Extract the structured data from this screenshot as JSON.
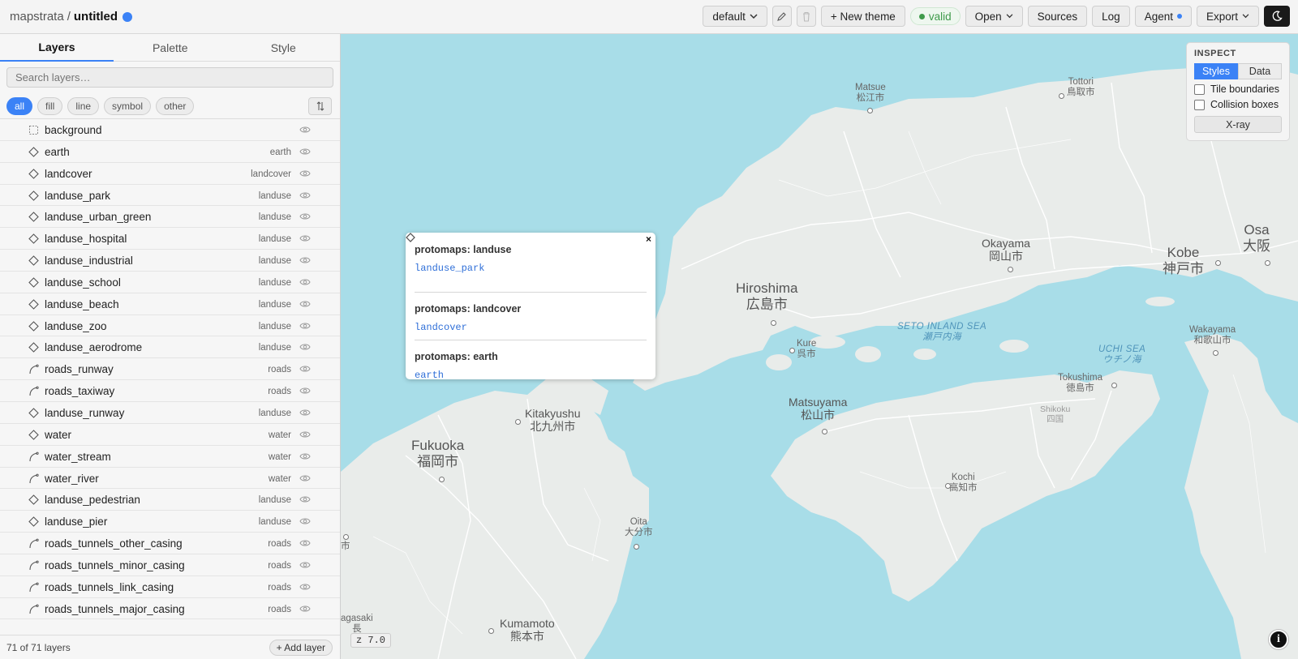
{
  "app": {
    "name": "mapstrata",
    "separator": "/",
    "document": "untitled"
  },
  "toolbar": {
    "theme_select": "default",
    "new_theme": "+ New theme",
    "status": "valid",
    "open": "Open",
    "sources": "Sources",
    "log": "Log",
    "agent": "Agent",
    "export": "Export"
  },
  "sidebar": {
    "tabs": [
      "Layers",
      "Palette",
      "Style"
    ],
    "search_placeholder": "Search layers…",
    "filters": [
      "all",
      "fill",
      "line",
      "symbol",
      "other"
    ],
    "layers": [
      {
        "name": "background",
        "source": "",
        "kind": "background"
      },
      {
        "name": "earth",
        "source": "earth",
        "kind": "fill"
      },
      {
        "name": "landcover",
        "source": "landcover",
        "kind": "fill"
      },
      {
        "name": "landuse_park",
        "source": "landuse",
        "kind": "fill"
      },
      {
        "name": "landuse_urban_green",
        "source": "landuse",
        "kind": "fill"
      },
      {
        "name": "landuse_hospital",
        "source": "landuse",
        "kind": "fill"
      },
      {
        "name": "landuse_industrial",
        "source": "landuse",
        "kind": "fill"
      },
      {
        "name": "landuse_school",
        "source": "landuse",
        "kind": "fill"
      },
      {
        "name": "landuse_beach",
        "source": "landuse",
        "kind": "fill"
      },
      {
        "name": "landuse_zoo",
        "source": "landuse",
        "kind": "fill"
      },
      {
        "name": "landuse_aerodrome",
        "source": "landuse",
        "kind": "fill"
      },
      {
        "name": "roads_runway",
        "source": "roads",
        "kind": "line"
      },
      {
        "name": "roads_taxiway",
        "source": "roads",
        "kind": "line"
      },
      {
        "name": "landuse_runway",
        "source": "landuse",
        "kind": "fill"
      },
      {
        "name": "water",
        "source": "water",
        "kind": "fill"
      },
      {
        "name": "water_stream",
        "source": "water",
        "kind": "line"
      },
      {
        "name": "water_river",
        "source": "water",
        "kind": "line"
      },
      {
        "name": "landuse_pedestrian",
        "source": "landuse",
        "kind": "fill"
      },
      {
        "name": "landuse_pier",
        "source": "landuse",
        "kind": "fill"
      },
      {
        "name": "roads_tunnels_other_casing",
        "source": "roads",
        "kind": "line"
      },
      {
        "name": "roads_tunnels_minor_casing",
        "source": "roads",
        "kind": "line"
      },
      {
        "name": "roads_tunnels_link_casing",
        "source": "roads",
        "kind": "line"
      },
      {
        "name": "roads_tunnels_major_casing",
        "source": "roads",
        "kind": "line"
      }
    ],
    "footer_count": "71 of 71 layers",
    "add_layer": "+ Add layer"
  },
  "popup": {
    "sections": [
      {
        "title": "protomaps: landuse",
        "item": "landuse_park"
      },
      {
        "title": "protomaps: landcover",
        "item": "landcover"
      },
      {
        "title": "protomaps: earth",
        "item": "earth"
      }
    ]
  },
  "inspect": {
    "title": "INSPECT",
    "modes": [
      "Styles",
      "Data"
    ],
    "options": [
      "Tile boundaries",
      "Collision boxes"
    ],
    "xray": "X-ray"
  },
  "map": {
    "zoom": "z 7.0",
    "labels": [
      {
        "text": "Matsue\n松江市",
        "cls": "sm"
      },
      {
        "text": "Tottori\n鳥取市",
        "cls": "sm"
      },
      {
        "text": "Osa\n大阪",
        "cls": "big"
      },
      {
        "text": "Okayama\n岡山市",
        "cls": "med"
      },
      {
        "text": "Kobe\n神戸市",
        "cls": "big"
      },
      {
        "text": "Hiroshima\n広島市",
        "cls": "big"
      },
      {
        "text": "SETO INLAND SEA\n瀬戸内海",
        "cls": "sea"
      },
      {
        "text": "Wakayama\n和歌山市",
        "cls": "sm"
      },
      {
        "text": "UCHI SEA\nウチノ海",
        "cls": "sea"
      },
      {
        "text": "Kure\n呉市",
        "cls": "sm"
      },
      {
        "text": "Tokushima\n徳島市",
        "cls": "sm"
      },
      {
        "text": "Kitakyushu\n北九州市",
        "cls": "med"
      },
      {
        "text": "Matsuyama\n松山市",
        "cls": "med"
      },
      {
        "text": "Shikoku\n四国",
        "cls": "region"
      },
      {
        "text": "Fukuoka\n福岡市",
        "cls": "big"
      },
      {
        "text": "Kochi\n高知市",
        "cls": "sm"
      },
      {
        "text": "Oita\n大分市",
        "cls": "sm"
      },
      {
        "text": "Kumamoto\n熊本市",
        "cls": "med"
      },
      {
        "text": "agasaki\n長",
        "cls": "sm"
      },
      {
        "text": "市",
        "cls": "sm"
      }
    ]
  },
  "colors": {
    "accent": "#3b82f6",
    "water": "#a8dde8",
    "land": "#e9ecea",
    "valid": "#3f9b4b"
  },
  "icons": [
    "pencil-icon",
    "trash-icon",
    "chevron-down-icon",
    "moon-icon",
    "eye-icon",
    "sort-icon",
    "info-icon",
    "close-icon"
  ]
}
